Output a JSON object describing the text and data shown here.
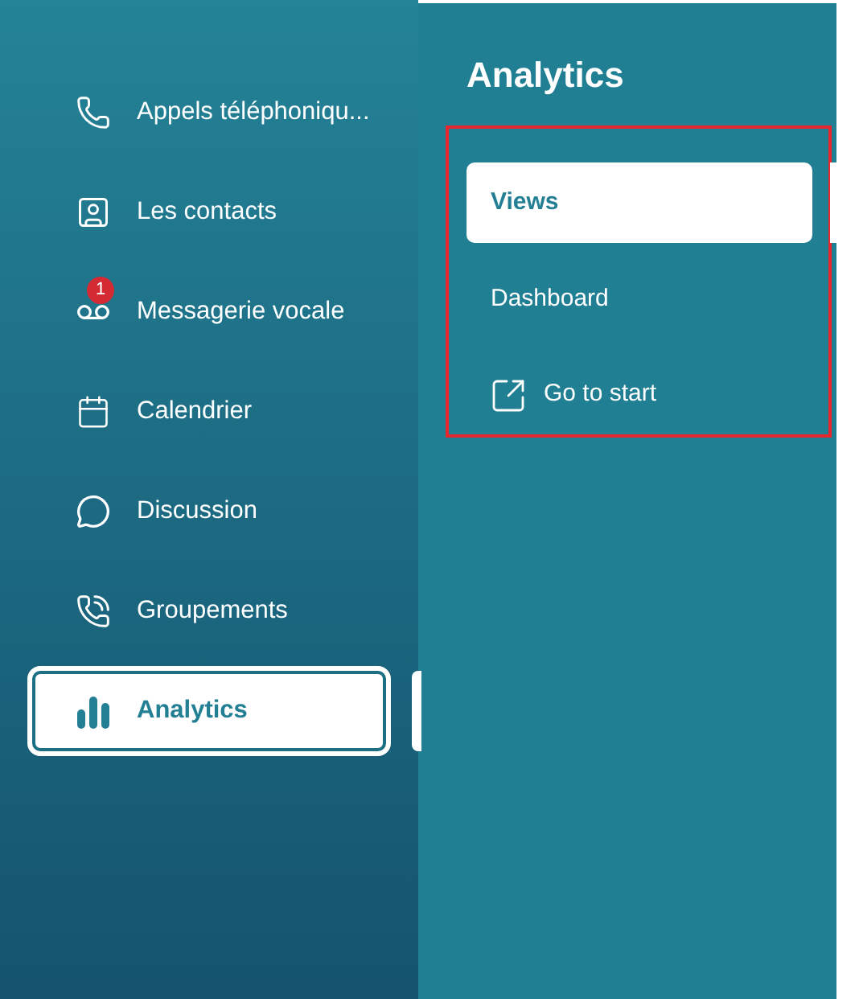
{
  "sidebar": {
    "items": [
      {
        "label": "Appels téléphoniqu...",
        "selected": false
      },
      {
        "label": "Les contacts",
        "selected": false
      },
      {
        "label": "Messagerie vocale",
        "selected": false,
        "badge": "1"
      },
      {
        "label": "Calendrier",
        "selected": false
      },
      {
        "label": "Discussion",
        "selected": false
      },
      {
        "label": "Groupements",
        "selected": false
      },
      {
        "label": "Analytics",
        "selected": true
      }
    ]
  },
  "panel": {
    "title": "Analytics",
    "items": [
      {
        "label": "Views",
        "selected": true
      },
      {
        "label": "Dashboard",
        "selected": false
      }
    ],
    "link": {
      "label": "Go to start"
    }
  }
}
